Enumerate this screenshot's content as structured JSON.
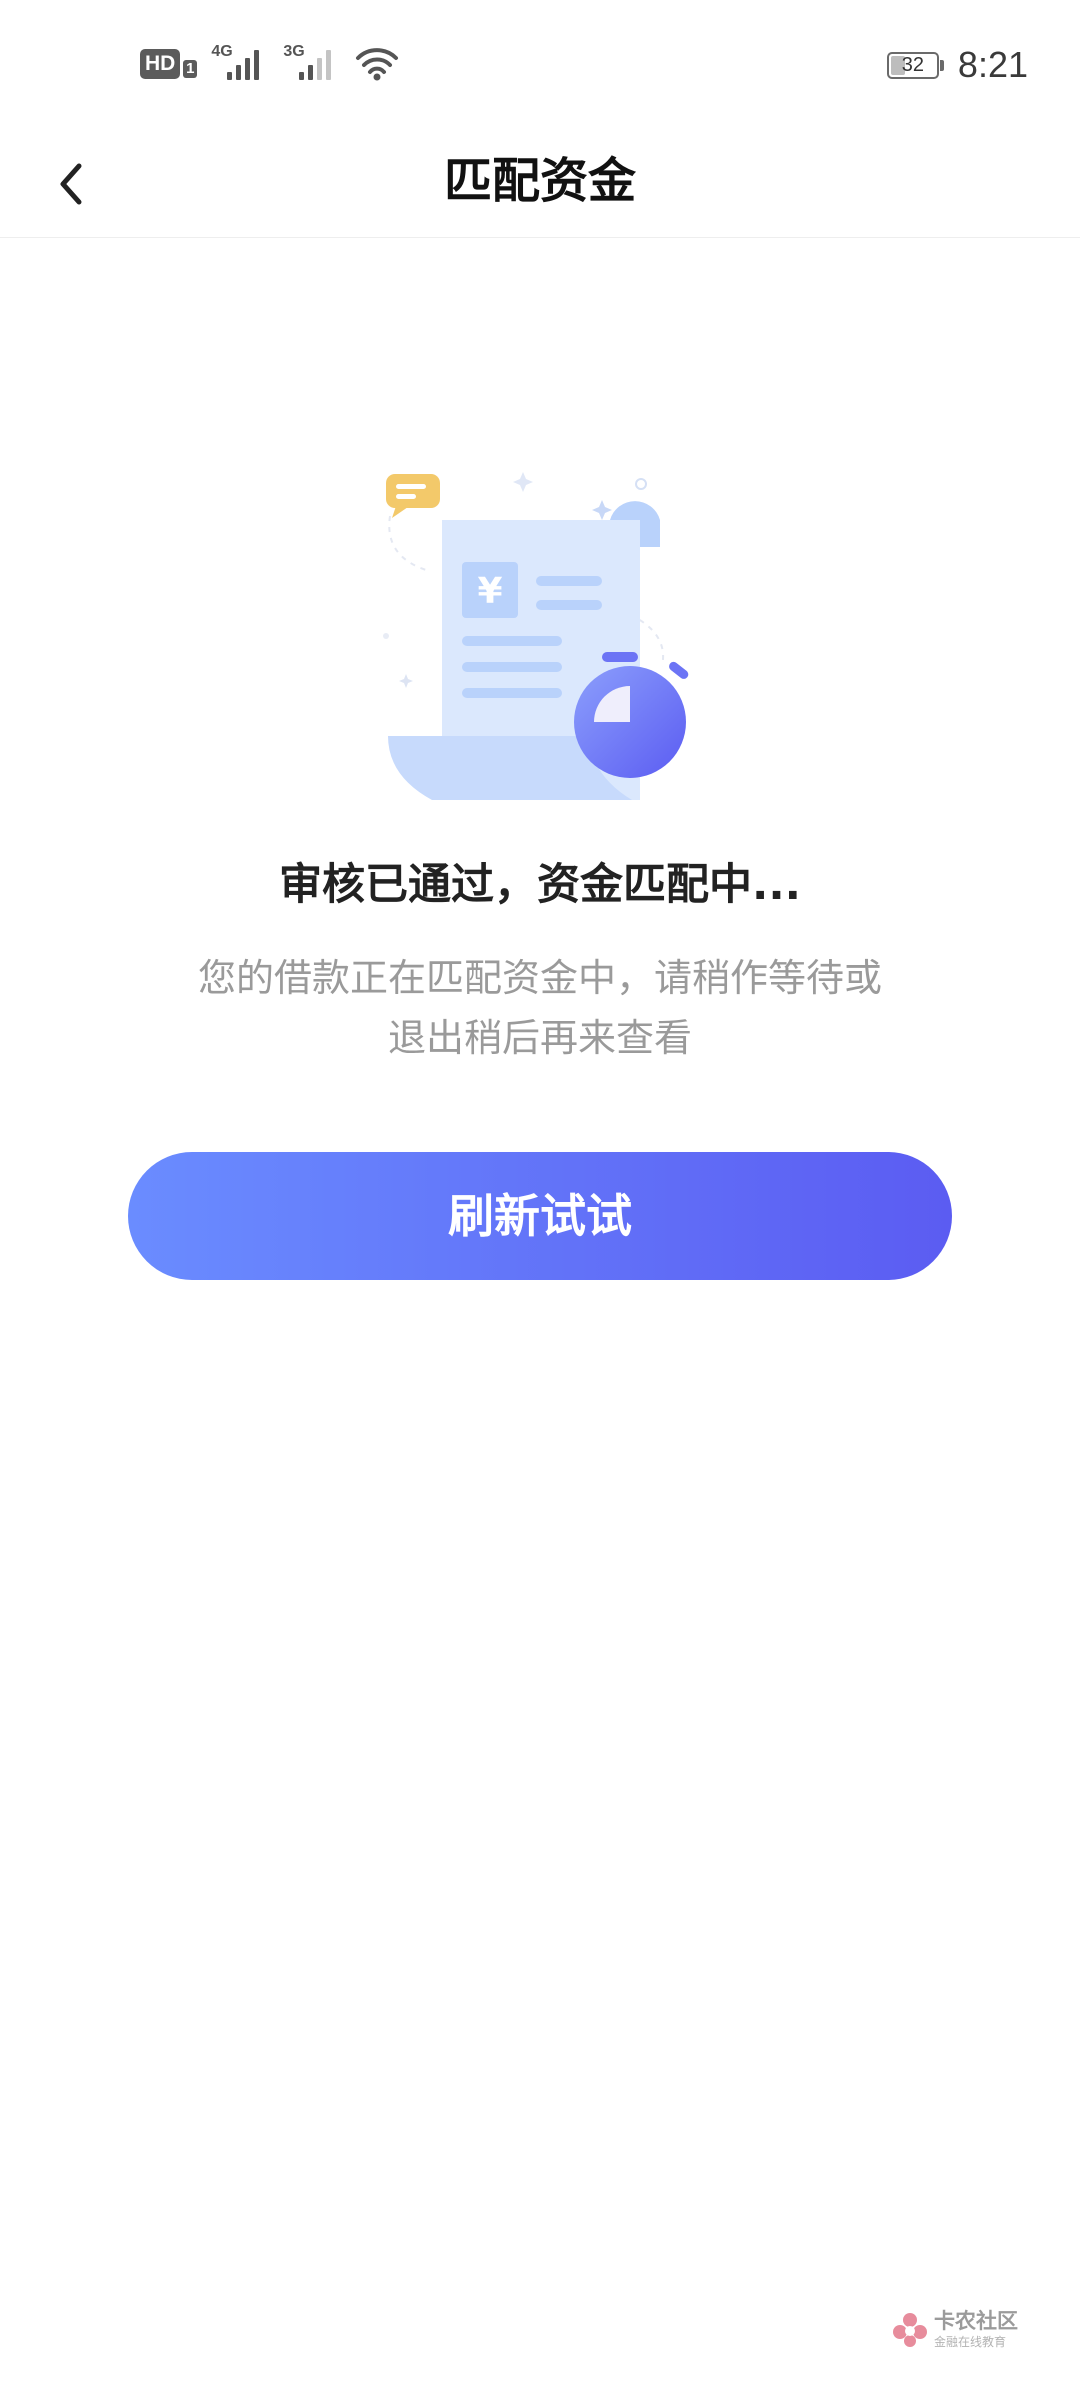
{
  "status_bar": {
    "hd_label": "HD",
    "sim_slot": "1",
    "signal_1_gen": "4G",
    "signal_2_gen": "3G",
    "battery_level": "32",
    "time": "8:21"
  },
  "nav": {
    "title": "匹配资金"
  },
  "main": {
    "status_title": "审核已通过，资金匹配中...",
    "status_desc_line1": "您的借款正在匹配资金中，请稍作等待或",
    "status_desc_line2": "退出稍后再来查看",
    "refresh_label": "刷新试试",
    "receipt_currency_symbol": "¥"
  },
  "watermark": {
    "name": "卡农社区",
    "sub": "金融在线教育"
  },
  "colors": {
    "button_gradient_start": "#6a8cff",
    "button_gradient_end": "#5b5cf2",
    "title_text": "#222222",
    "desc_text": "#9a9a9a",
    "illustration_light_blue": "#dbe8fd",
    "illustration_mid_blue": "#b9d2fb",
    "illustration_accent_yellow": "#f3c96a"
  },
  "icons": {
    "back": "chevron-left-icon",
    "illustration": "receipt-stopwatch-illustration",
    "wifi": "wifi-icon",
    "battery": "battery-icon"
  }
}
